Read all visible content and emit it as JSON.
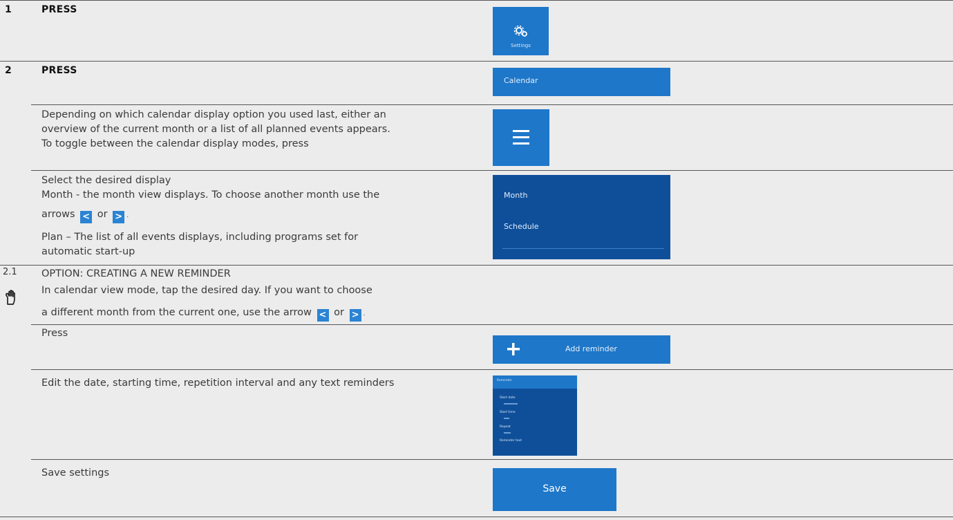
{
  "steps": {
    "s1": {
      "num": "1",
      "action": "PRESS",
      "button_label": "Settings"
    },
    "s2": {
      "num": "2",
      "action": "PRESS",
      "button_label": "Calendar"
    },
    "depending": {
      "l1": "Depending on which calendar display option you used last, either an",
      "l2": "overview of the current month or a list of all planned events appears.",
      "l3": "To toggle between the calendar display modes, press"
    },
    "select": {
      "l1": "Select the desired display",
      "l2": "Month - the month view displays. To choose another month use the",
      "l3a": "arrows",
      "or": "or",
      "dot": ".",
      "l4": "Plan – The list of all events displays, including programs set for",
      "l5": "automatic start-up",
      "menu_month": "Month",
      "menu_schedule": "Schedule"
    },
    "s21": {
      "num": "2.1",
      "title": "OPTION: CREATING A NEW REMINDER",
      "l1": "In calendar view mode, tap the desired day. If you want to choose",
      "l2a": "a different month from the current one, use the arrow",
      "or": "or",
      "dot": "."
    },
    "press_add": {
      "text": "Press",
      "button_label": "Add reminder"
    },
    "edit": {
      "text": "Edit the date, starting time, repetition interval and any text reminders",
      "screen_title": "Reminder",
      "fields": [
        "Start date",
        "Start time",
        "Repeat",
        "Reminder text"
      ]
    },
    "save": {
      "text": "Save settings",
      "button_label": "Save"
    }
  },
  "icons": {
    "arrow_left": "chevron-left",
    "arrow_right": "chevron-right",
    "hand": "hand-pointer",
    "gears": "gears",
    "menu": "hamburger",
    "plus": "plus"
  },
  "colors": {
    "button_blue": "#1e77c9",
    "dark_blue": "#0f4f9a"
  }
}
